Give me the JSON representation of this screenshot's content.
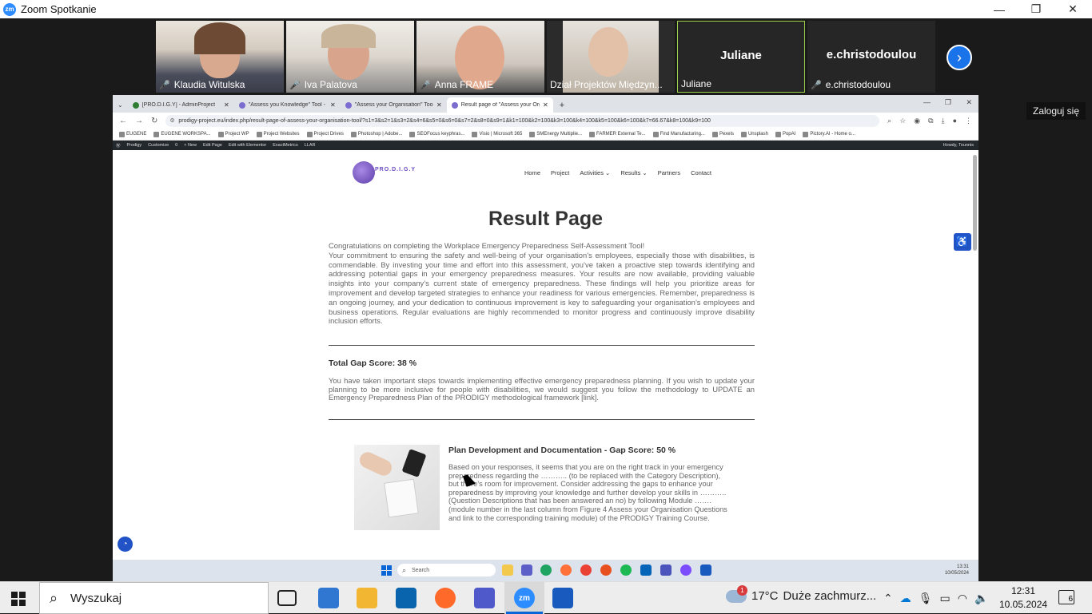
{
  "zoom": {
    "title": "Zoom Spotkanie",
    "logo": "zm",
    "login": "Zaloguj się"
  },
  "participants": [
    {
      "name": "Klaudia Witulska",
      "video": true
    },
    {
      "name": "Iva Palatova",
      "video": true
    },
    {
      "name": "Anna FRAME",
      "video": true
    },
    {
      "name": "Dział Projektów Międzyn...",
      "video": true
    },
    {
      "name": "Juliane",
      "big": "Juliane",
      "video": false
    },
    {
      "name": "e.christodoulou",
      "big": "e.christodoulou",
      "video": false
    }
  ],
  "browser": {
    "tabs": [
      "[PRO.D.I.G.Y] - AdminProject",
      "\"Assess you Knowledge\" Tool -",
      "\"Assess your Organisation\" Tool",
      "Result page of \"Assess your Org..."
    ],
    "url": "prodigy-project.eu/index.php/result-page-of-assess-your-organisation-tool/?s1=3&s2=1&s3=2&s4=6&s5=0&s6=0&s7=2&s8=0&s9=1&k1=100&k2=100&k3=100&k4=100&k5=100&k6=100&k7=66.67&k8=100&k9=100",
    "bookmarks": [
      "EUGENE",
      "EUGENE WORKSPA...",
      "Project WP",
      "Project Websites",
      "Project Drives",
      "Photoshop | Adobe...",
      "SEOFocus keyphras...",
      "Visio | Microsoft 365",
      "SMEnergy Multiplie...",
      "FARMER External Te...",
      "Find Manufacturing...",
      "Pexels",
      "Unsplash",
      "PopAI",
      "Pictory.AI - Home o..."
    ],
    "wpbar": [
      "Prodigy",
      "Customize",
      "0",
      "+ New",
      "Edit Page",
      "Edit with Elementor",
      "ExactMetrics",
      "LLAR"
    ],
    "wpbar_right": "Howdy, Tounnis"
  },
  "site": {
    "logo": "PRO.D.I.G.Y",
    "menu": [
      "Home",
      "Project",
      "Activities ⌄",
      "Results ⌄",
      "Partners",
      "Contact"
    ],
    "title": "Result Page",
    "intro": "Congratulations on completing the Workplace Emergency Preparedness Self-Assessment Tool!\nYour commitment to ensuring the safety and well-being of your organisation’s employees, especially those with disabilities, is commendable. By investing your time and effort into this assessment, you’ve taken a proactive step towards identifying and addressing potential gaps in your emergency preparedness measures. Your results are now available, providing valuable insights into your company’s current state of emergency preparedness. These findings will help you prioritize areas for improvement and develop targeted strategies to enhance your readiness for various emergencies. Remember, preparedness is an ongoing journey, and your dedication to continuous improvement is key to safeguarding your organisation’s employees and business operations. Regular evaluations are highly recommended to monitor progress and continuously improve disability inclusion efforts.",
    "total_gap": "Total Gap Score: 38 %",
    "total_text": "You have taken important steps towards implementing effective emergency preparedness planning. If you wish to update your planning to be more inclusive for people with disabilities, we would suggest you follow the methodology to UPDATE an Emergency Preparedness Plan of the PRODIGY methodological framework [link].",
    "section_title": "Plan Development and Documentation - Gap Score: 50 %",
    "section_text": "Based on your responses, it seems that you are on the right track in your emergency preparedness regarding the ……….. (to be replaced with the Category Description), but there’s room for improvement. Consider addressing the gaps to enhance your preparedness by improving your knowledge and further develop your skills in ……….. (Question Descriptions that has been answered an no) by following Module ……. (module number in the last column from Figure 4 Assess your Organisation Questions and link to the corresponding training module) of the PRODIGY Training Course."
  },
  "inner_taskbar": {
    "search": "Search",
    "time": "13:31",
    "date": "10/05/2024"
  },
  "taskbar": {
    "search": "Wyszukaj",
    "temp": "17°C",
    "weather": "Duże zachmurz...",
    "badge": "1",
    "time": "12:31",
    "date": "10.05.2024",
    "notifications": "6"
  }
}
